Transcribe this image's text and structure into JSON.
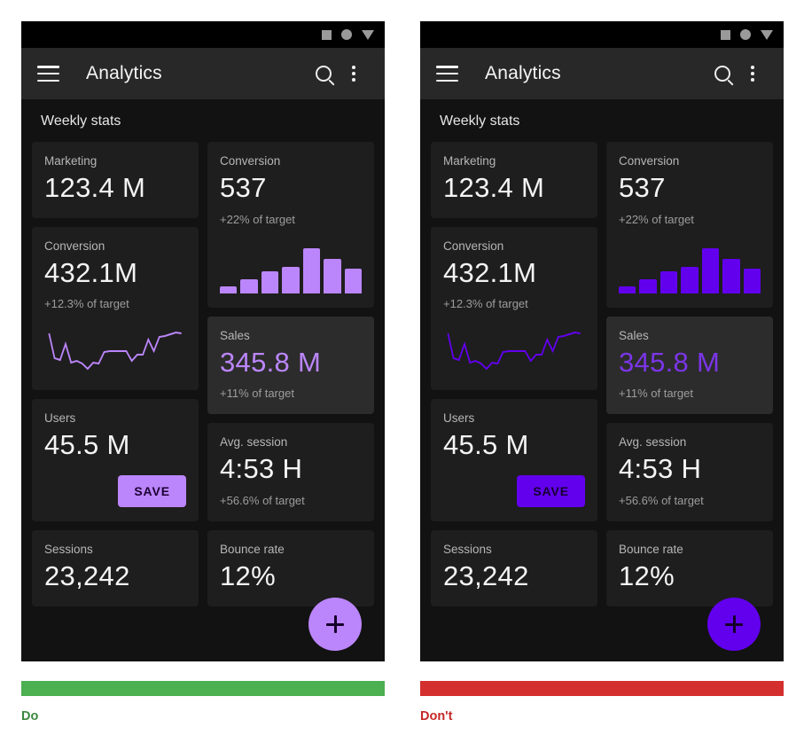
{
  "panels": [
    {
      "id": "do",
      "verdict_label": "Do",
      "verdict_color": "#4caf50",
      "accent": "#bb86fc",
      "accent_name": "light-purple",
      "statusbar": {
        "icons": [
          "square-icon",
          "circle-icon",
          "dropdown-triangle-icon"
        ]
      },
      "appbar": {
        "menu_icon": "hamburger-menu-icon",
        "title": "Analytics",
        "search_icon": "search-icon",
        "overflow_icon": "more-vert-icon"
      },
      "section_title": "Weekly stats",
      "cards": {
        "marketing": {
          "label": "Marketing",
          "value": "123.4 M"
        },
        "conversion_bars": {
          "label": "Conversion",
          "value": "537",
          "sub": "+22% of target"
        },
        "conversion_line": {
          "label": "Conversion",
          "value": "432.1M",
          "sub": "+12.3% of target"
        },
        "sales": {
          "label": "Sales",
          "value": "345.8 M",
          "sub": "+11% of target"
        },
        "users": {
          "label": "Users",
          "value": "45.5 M",
          "save_label": "SAVE"
        },
        "avg_session": {
          "label": "Avg. session",
          "value": "4:53 H",
          "sub": "+56.6% of target"
        },
        "sessions": {
          "label": "Sessions",
          "value": "23,242"
        },
        "bounce_rate": {
          "label": "Bounce rate",
          "value": "12%"
        }
      },
      "fab": {
        "icon": "plus-icon"
      }
    },
    {
      "id": "dont",
      "verdict_label": "Don't",
      "verdict_color": "#d32f2f",
      "accent": "#6200ee",
      "accent_name": "saturated-purple",
      "statusbar": {
        "icons": [
          "square-icon",
          "circle-icon",
          "dropdown-triangle-icon"
        ]
      },
      "appbar": {
        "menu_icon": "hamburger-menu-icon",
        "title": "Analytics",
        "search_icon": "search-icon",
        "overflow_icon": "more-vert-icon"
      },
      "section_title": "Weekly stats",
      "cards": {
        "marketing": {
          "label": "Marketing",
          "value": "123.4 M"
        },
        "conversion_bars": {
          "label": "Conversion",
          "value": "537",
          "sub": "+22% of target"
        },
        "conversion_line": {
          "label": "Conversion",
          "value": "432.1M",
          "sub": "+12.3% of target"
        },
        "sales": {
          "label": "Sales",
          "value": "345.8 M",
          "sub": "+11% of target"
        },
        "users": {
          "label": "Users",
          "value": "45.5 M",
          "save_label": "SAVE"
        },
        "avg_session": {
          "label": "Avg. session",
          "value": "4:53 H",
          "sub": "+56.6% of target"
        },
        "sessions": {
          "label": "Sessions",
          "value": "23,242"
        },
        "bounce_rate": {
          "label": "Bounce rate",
          "value": "12%"
        }
      },
      "fab": {
        "icon": "plus-icon"
      }
    }
  ],
  "chart_data": [
    {
      "type": "bar",
      "title": "Conversion",
      "categories": [
        "1",
        "2",
        "3",
        "4",
        "5",
        "6",
        "7"
      ],
      "values": [
        12,
        26,
        40,
        48,
        82,
        62,
        44
      ],
      "ylim": [
        0,
        100
      ],
      "xlabel": "",
      "ylabel": "",
      "grid": false,
      "legend": "none"
    },
    {
      "type": "line",
      "title": "Conversion",
      "x": [
        0,
        1,
        2,
        3,
        4,
        5,
        6,
        7,
        8,
        9,
        10,
        11,
        12,
        13,
        14,
        15,
        16,
        17,
        18,
        19,
        20,
        21,
        22,
        23,
        24
      ],
      "values": [
        78,
        34,
        30,
        56,
        24,
        26,
        22,
        14,
        26,
        24,
        44,
        46,
        46,
        46,
        46,
        28,
        40,
        40,
        68,
        46,
        72,
        74,
        76,
        80,
        78
      ],
      "ylim": [
        0,
        100
      ],
      "xlabel": "",
      "ylabel": "",
      "grid": false,
      "legend": "none"
    }
  ]
}
